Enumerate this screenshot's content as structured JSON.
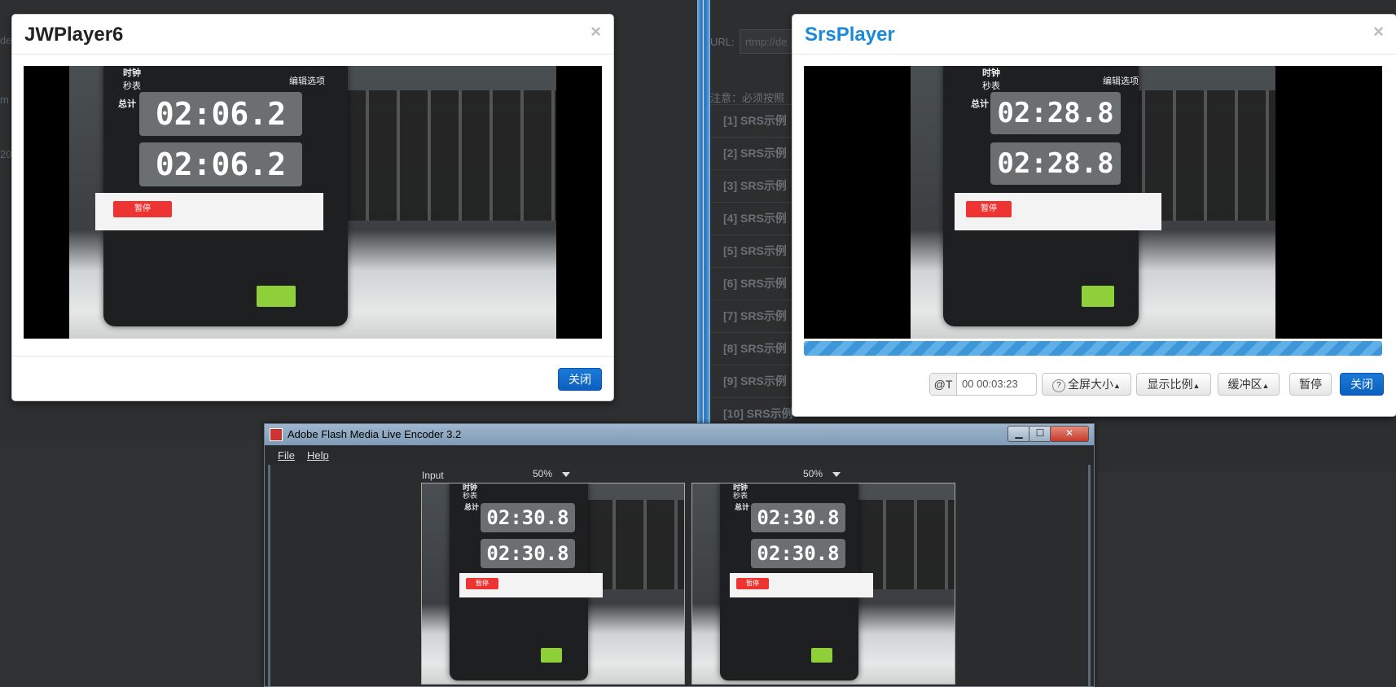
{
  "background": {
    "url_label": "URL:",
    "url_value": "rtmp://de",
    "note": "注意：必须按照",
    "left_frag_1": "de",
    "left_frag_2": "m",
    "left_frag_3": "20",
    "list_items": [
      "[1] SRS示例",
      "[2] SRS示例",
      "[3] SRS示例",
      "[4] SRS示例",
      "[5] SRS示例",
      "[6] SRS示例",
      "[7] SRS示例",
      "[8] SRS示例",
      "[9] SRS示例",
      "[10] SRS示例"
    ]
  },
  "jwplayer": {
    "title": "JWPlayer6",
    "close_x": "×",
    "close_button": "关闭",
    "clock_total_label": "总计",
    "clock_time_1": "02:06.2",
    "clock_time_2": "02:06.2",
    "clock_pause": "暂停",
    "clock_top_left": "时钟",
    "clock_top_left_sub": "秒表",
    "clock_top_right": "编辑选项"
  },
  "srsplayer": {
    "title": "SrsPlayer",
    "title_color": "#1a8ad8",
    "close_x": "×",
    "time_prefix": "@T",
    "time_value": "00 00:03:23",
    "fullscreen_label": "全屏大小",
    "ratio_label": "显示比例",
    "buffer_label": "缓冲区",
    "pause_label": "暂停",
    "close_button": "关闭",
    "clock_total_label": "总计",
    "clock_time_1": "02:28.8",
    "clock_time_2": "02:28.8",
    "clock_pause": "暂停",
    "clock_top_left": "时钟",
    "clock_top_left_sub": "秒表",
    "clock_top_right": "编辑选项"
  },
  "encoder": {
    "title": "Adobe Flash Media Live Encoder 3.2",
    "menu_file": "File",
    "menu_help": "Help",
    "input_label": "Input",
    "input_zoom": "50%",
    "output_zoom": "50%",
    "clock_total_label": "总计",
    "clock_time_1": "02:30.8",
    "clock_time_2": "02:30.8",
    "clock_pause": "暂停",
    "clock_top_left": "时钟",
    "clock_top_left_sub": "秒表"
  }
}
